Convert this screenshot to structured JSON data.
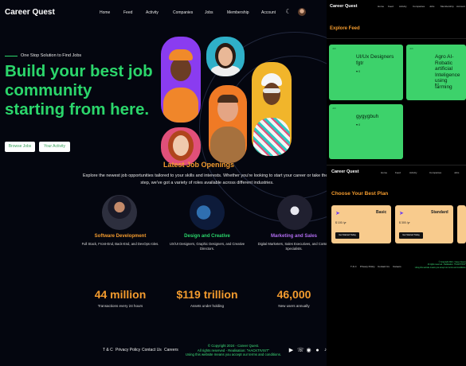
{
  "main": {
    "brand": "Career Quest",
    "nav": [
      "Home",
      "Feed",
      "Activity",
      "Companies",
      "Jobs",
      "Membership",
      "Account"
    ],
    "icons": {
      "theme": "moon-icon",
      "avatar": "user-avatar"
    },
    "tagline": "One Stop Solution to Find Jobs",
    "hero_title": "Build your best job community starting from here.",
    "buttons": {
      "browse": "Browse Jobs",
      "activity": "Your Activity"
    },
    "latest_heading": "Latest Job Openings",
    "latest_desc": "Explore the newest job opportunities tailored to your skills and interests. Whether you're looking to start your career or take the n step, we've got a variety of roles available across different industries.",
    "categories": [
      {
        "title": "Software Development",
        "desc": "Full Stack, Front-End, Back-End, and DevOps roles.",
        "color": "#f39b2e"
      },
      {
        "title": "Design and Creative",
        "desc": "UX/UI Designers, Graphic Designers, and Creative Directors.",
        "color": "#2bd66b"
      },
      {
        "title": "Marketing and Sales",
        "desc": "Digital Marketers, Sales Executives, and Content Specialists.",
        "color": "#b06cf0"
      }
    ],
    "stats": [
      {
        "value": "44 million",
        "label": "Transactions every 24 hours"
      },
      {
        "value": "$119 trillion",
        "label": "Assets under holding"
      },
      {
        "value": "46,000",
        "label": "New users annually"
      }
    ],
    "footer": {
      "links": [
        "T & C",
        "Privacy Policy",
        "Contact Us",
        "Careers"
      ],
      "copyright": "© Copyright 2024 - Career Quest.",
      "rights": "All rights reserved - Realisation: \"HACKTIVIST\"",
      "terms": "Using this website means you accept our terms and conditions.",
      "social": [
        "youtube-icon",
        "whatsapp-icon",
        "instagram-icon",
        "facebook-icon",
        "tiktok-icon"
      ]
    }
  },
  "feed_panel": {
    "brand": "Career Quest",
    "nav": [
      "Home",
      "Feed",
      "Activity",
      "Companies",
      "Jobs",
      "Membership",
      "Account"
    ],
    "heading": "Explore Feed",
    "cards": [
      {
        "tag": "Job",
        "title": "UI/Ux Designers fgtr",
        "likes": "0"
      },
      {
        "tag": "Job",
        "title": "Agro AI-Robatic artificial Inteligence using farming",
        "likes": "0"
      },
      {
        "tag": "Job",
        "title": "gygygbuh",
        "likes": "0"
      }
    ]
  },
  "plan_panel": {
    "brand": "Career Quest",
    "nav": [
      "Home",
      "Feed",
      "Activity",
      "Companies",
      "Jobs"
    ],
    "heading": "Choose Your Best Plan",
    "plans": [
      {
        "name": "Basic",
        "price": "$ 100 /yr",
        "button": "Get Started Today"
      },
      {
        "name": "Standard",
        "price": "$ 300 /yr",
        "button": "Get Started Today"
      }
    ],
    "footer_links": [
      "T & C",
      "Privacy Policy",
      "Contact Us",
      "Careers"
    ],
    "copyright": "© Copyright 2024 - Career Quest.",
    "rights": "All rights reserved - Realisation: \"HACKTIVIST\"",
    "terms": "Using this website means you accept our terms and conditions."
  },
  "colors": {
    "accent_green": "#2bd66b",
    "accent_orange": "#f39b2e",
    "background": "#04060f"
  }
}
